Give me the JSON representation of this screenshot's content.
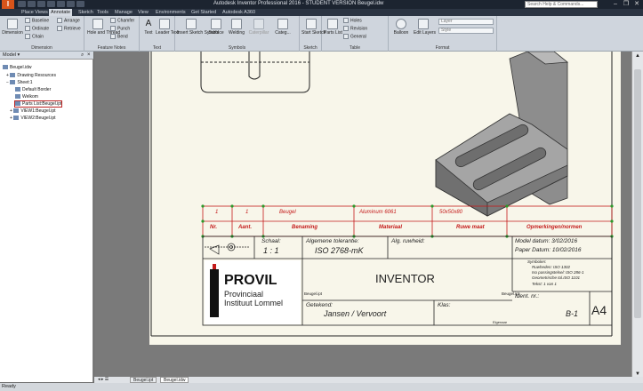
{
  "titlebar": {
    "app_letter": "I",
    "title": "Autodesk Inventor Professional 2016 - STUDENT VERSION   Beugel.idw"
  },
  "tabs": [
    "Place Views",
    "Annotate",
    "Sketch",
    "Tools",
    "Manage",
    "View",
    "Environments",
    "Get Started",
    "Autodesk A360"
  ],
  "active_tab": "Annotate",
  "search": {
    "placeholder": "Search Help & Commands..."
  },
  "ribbon": {
    "dimension": {
      "label": "Dimension",
      "baseline": "Baseline",
      "ordinate": "Ordinate",
      "chain": "Chain",
      "arrange": "Arrange",
      "retrieve": "Retrieve",
      "group": "Dimension"
    },
    "feature_notes": {
      "hole_thread": "Hole and Thread",
      "chamfer": "Chamfer",
      "punch": "Punch",
      "bend": "Bend",
      "group": "Feature Notes"
    },
    "text": {
      "text": "Text",
      "leader_text": "Leader Text",
      "group": "Text"
    },
    "symbols": {
      "sketch_symbol": "Insert Sketch Symbol",
      "surface": "Surface",
      "welding": "Welding",
      "caterpillar": "Caterpillar",
      "datum": "Datum",
      "categ": "Categ...",
      "group": "Symbols"
    },
    "sketch": {
      "start_sketch": "Start Sketch",
      "group": "Sketch"
    },
    "table": {
      "parts_list": "Parts List",
      "holes": "Holes",
      "revision": "Revision",
      "general": "General",
      "group": "Table"
    },
    "format": {
      "balloon": "Balloon",
      "edit_layers": "Edit Layers",
      "layer_combo": "Layer",
      "style_combo": "Style",
      "group": "Format"
    }
  },
  "panel": {
    "title": "Model ▾",
    "tree": [
      "Beugel.idw",
      "Drawing Resources",
      "Sheet:1",
      "Default Border",
      "Welkom",
      "Parts List:Beugel.ipt",
      "VIEW1:Beugel.ipt",
      "VIEW2:Beugel.ipt"
    ]
  },
  "parts_list": {
    "row": [
      "1",
      "1",
      "Beugel",
      "Aluminum 6061",
      "50x50x80",
      ""
    ],
    "header": [
      "Nr.",
      "Aant.",
      "Benaming",
      "Materiaal",
      "Ruwe maat",
      "Opmerkingen/normen"
    ]
  },
  "title_block": {
    "schaal_label": "Schaal:",
    "schaal": "1 : 1",
    "tol_label": "Algemene tolerantie:",
    "tol": "ISO 2768-mK",
    "ruwheid_label": "Alg. ruwheid:",
    "model_datum": "Model datum: 3/02/2016",
    "paper_datum": "Paper Datum: 10/02/2016",
    "symbolen": [
      "Symbolen:",
      "Ruwheden: ISO 1302",
      "Iso passingstelsel: ISO 286-1",
      "Geometrische tol.ISO 1101",
      "Tekst: 1 van 1"
    ],
    "logo_main": "PROVIL",
    "logo_sub1": "Provinciaal",
    "logo_sub2": "Instituut Lommel",
    "drawing_title": "INVENTOR",
    "small_file1": "Beugel.ipt",
    "small_file2": "Beugel.ipt",
    "getekend_label": "Getekend:",
    "getekend": "Jansen / Vervoort",
    "klas_label": "Klas:",
    "eigenaar": "Eigenaar",
    "ident_label": "Ident. nr.:",
    "ident": "B-1",
    "size": "A4"
  },
  "doc_tabs": [
    "Beugel.ipt",
    "Beugel.idw"
  ],
  "status": "Ready",
  "colors": {
    "red_lines": "#c41a1a",
    "sheet": "#f8f6ea",
    "part_face": "#9a9a9a"
  }
}
